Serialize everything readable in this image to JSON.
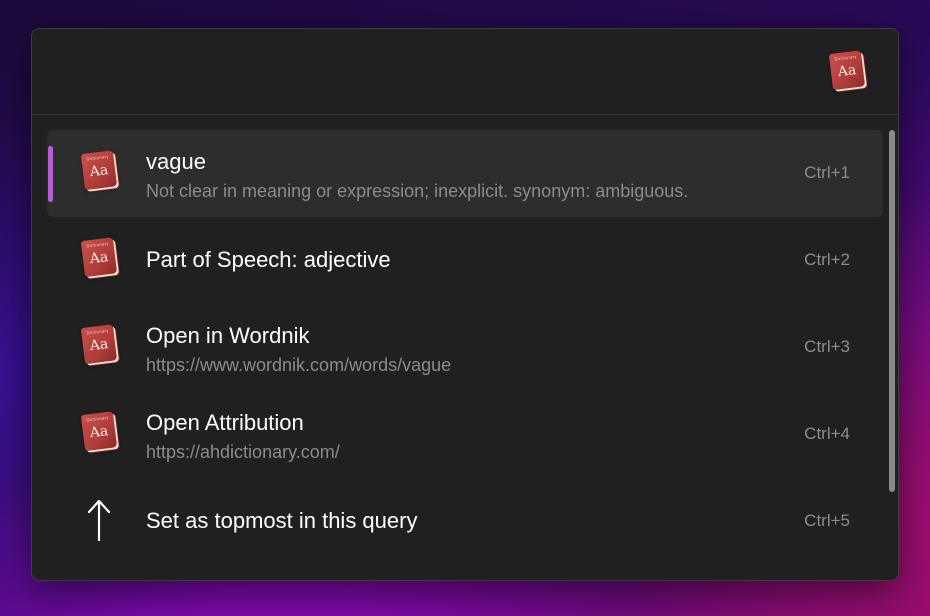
{
  "search": {
    "value": "",
    "placeholder": ""
  },
  "results": [
    {
      "title": "vague",
      "subtitle": "Not clear in meaning or expression; inexplicit. synonym:  ambiguous.",
      "shortcut": "Ctrl+1",
      "icon": "dictionary-book-icon",
      "selected": true
    },
    {
      "title": "Part of Speech: adjective",
      "subtitle": "",
      "shortcut": "Ctrl+2",
      "icon": "dictionary-book-icon"
    },
    {
      "title": "Open in Wordnik",
      "subtitle": "https://www.wordnik.com/words/vague",
      "shortcut": "Ctrl+3",
      "icon": "dictionary-book-icon"
    },
    {
      "title": "Open Attribution",
      "subtitle": "https://ahdictionary.com/",
      "shortcut": "Ctrl+4",
      "icon": "dictionary-book-icon"
    },
    {
      "title": "Set as topmost in this query",
      "subtitle": "",
      "shortcut": "Ctrl+5",
      "icon": "arrow-up-icon"
    }
  ],
  "icons": {
    "book_small_text": "Dictionary",
    "book_label": "Aa"
  },
  "colors": {
    "accent": "#b65fd0",
    "panel": "#202020",
    "selected_row": "#2d2d2d",
    "book_cover": "#b03d3a"
  }
}
